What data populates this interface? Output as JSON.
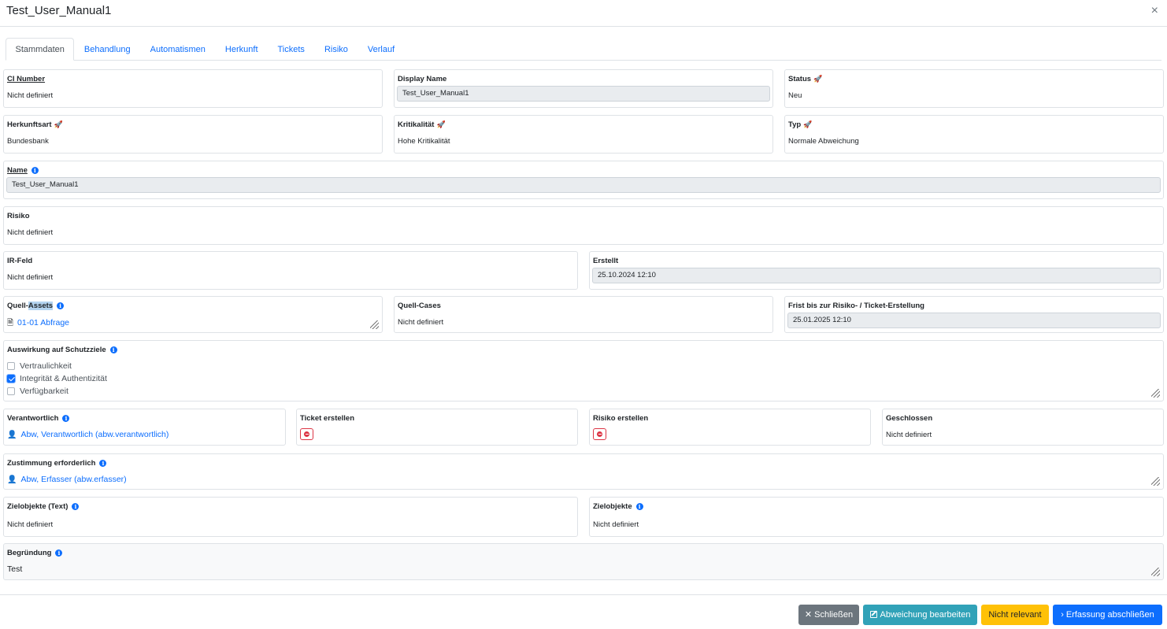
{
  "modal": {
    "title": "Test_User_Manual1",
    "close_icon": "×"
  },
  "tabs": [
    {
      "label": "Stammdaten",
      "active": true
    },
    {
      "label": "Behandlung"
    },
    {
      "label": "Automatismen"
    },
    {
      "label": "Herkunft"
    },
    {
      "label": "Tickets"
    },
    {
      "label": "Risiko"
    },
    {
      "label": "Verlauf"
    }
  ],
  "fields": {
    "ci_number": {
      "label": "CI Number",
      "value": "Nicht definiert"
    },
    "display_name": {
      "label": "Display Name",
      "value": "Test_User_Manual1"
    },
    "status": {
      "label": "Status",
      "value": "Neu"
    },
    "herkunftsart": {
      "label": "Herkunftsart",
      "value": "Bundesbank"
    },
    "kritikalitaet": {
      "label": "Kritikalität",
      "value": "Hohe Kritikalität"
    },
    "typ": {
      "label": "Typ",
      "value": "Normale Abweichung"
    },
    "name": {
      "label": "Name",
      "value": "Test_User_Manual1"
    },
    "risiko": {
      "label": "Risiko",
      "value": "Nicht definiert"
    },
    "ir_feld": {
      "label": "IR-Feld",
      "value": "Nicht definiert"
    },
    "erstellt": {
      "label": "Erstellt",
      "value": "25.10.2024 12:10"
    },
    "quell_assets": {
      "label_a": "Quell-",
      "label_b": "Assets",
      "value": "01-01 Abfrage"
    },
    "quell_cases": {
      "label": "Quell-Cases",
      "value": "Nicht definiert"
    },
    "frist": {
      "label": "Frist bis zur Risiko- / Ticket-Erstellung",
      "value": "25.01.2025 12:10"
    },
    "schutzziele": {
      "label": "Auswirkung auf Schutzziele",
      "options": [
        {
          "label": "Vertraulichkeit",
          "checked": false
        },
        {
          "label": "Integrität & Authentizität",
          "checked": true
        },
        {
          "label": "Verfügbarkeit",
          "checked": false
        }
      ]
    },
    "verantwortlich": {
      "label": "Verantwortlich",
      "value": "Abw, Verantwortlich (abw.verantwortlich)"
    },
    "ticket_erstellen": {
      "label": "Ticket erstellen"
    },
    "risiko_erstellen": {
      "label": "Risiko erstellen"
    },
    "geschlossen": {
      "label": "Geschlossen",
      "value": "Nicht definiert"
    },
    "zustimmung": {
      "label": "Zustimmung erforderlich",
      "value": "Abw, Erfasser (abw.erfasser)"
    },
    "zielobjekte_text": {
      "label": "Zielobjekte (Text)",
      "value": "Nicht definiert"
    },
    "zielobjekte": {
      "label": "Zielobjekte",
      "value": "Nicht definiert"
    },
    "begruendung": {
      "label": "Begründung",
      "value": "Test"
    }
  },
  "footer": {
    "close_label": "Schließen",
    "edit_label": "Abweichung bearbeiten",
    "not_relevant_label": "Nicht relevant",
    "finish_label": "Erfassung abschließen"
  },
  "icons": {
    "info": "i",
    "rocket": "🚀",
    "asset": "🗎",
    "user": "👤",
    "chevron": "›",
    "x": "✕"
  },
  "colors": {
    "primary": "#0d6efd",
    "secondary": "#6c757d",
    "info": "#31a2b8",
    "warning": "#ffc107",
    "danger": "#dc3545"
  }
}
